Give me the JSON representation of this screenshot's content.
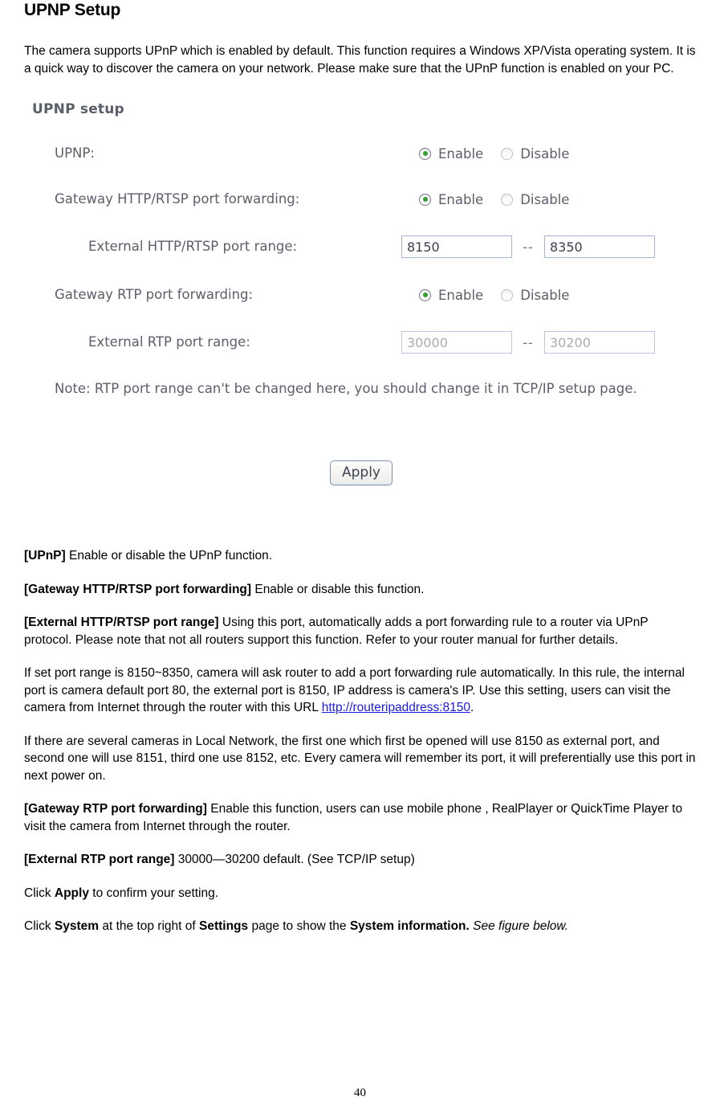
{
  "document": {
    "title": "UPNP Setup",
    "intro": "The camera supports UPnP which is enabled by default. This function requires a Windows XP/Vista operating system. It is a quick way to discover the camera on your network. Please make sure that the UPnP function is enabled on your PC.",
    "page_number": "40"
  },
  "screenshot": {
    "heading": "UPNP setup",
    "rows": {
      "upnp": {
        "label": "UPNP:",
        "enable_label": "Enable",
        "disable_label": "Disable",
        "selected": "Enable"
      },
      "gateway_http": {
        "label": "Gateway HTTP/RTSP port forwarding:",
        "enable_label": "Enable",
        "disable_label": "Disable",
        "selected": "Enable"
      },
      "external_http_range": {
        "label": "External HTTP/RTSP port range:",
        "from_value": "8150",
        "separator": "--",
        "to_value": "8350"
      },
      "gateway_rtp": {
        "label": "Gateway RTP port forwarding:",
        "enable_label": "Enable",
        "disable_label": "Disable",
        "selected": "Enable"
      },
      "external_rtp_range": {
        "label": "External RTP port range:",
        "from_value": "30000",
        "separator": "--",
        "to_value": "30200"
      }
    },
    "note": "Note: RTP port range can't be changed here, you should change it in TCP/IP setup page.",
    "apply_label": "Apply",
    "colors": {
      "label_text": "#5b5f6b",
      "radio_selected_dot": "#2ea12e",
      "field_border": "#a6b6d2",
      "disabled_text": "#a9acb4",
      "button_border": "#7d93b5"
    }
  },
  "explanations": {
    "p1_term": "[UPnP]",
    "p1_text": " Enable or disable the UPnP function.",
    "p2_term": "[Gateway HTTP/RTSP port forwarding]",
    "p2_text": " Enable or disable this function.",
    "p3_term": "[External HTTP/RTSP port range]",
    "p3_text": " Using this port, automatically adds a port forwarding rule to a router via UPnP protocol. Please note that not all routers support this function. Refer to your router manual for further details.",
    "p4_before_link": "If set port range is 8150~8350, camera will ask router to add a port forwarding rule automatically. In this rule, the internal port is camera default port 80, the external port is 8150, IP address is camera's IP. Use this setting, users can visit the camera from Internet through the router with this URL ",
    "p4_link": "http://routeripaddress:8150",
    "p4_after_link": ".",
    "p5_text": "If there are several cameras in Local Network, the first one which first be opened will use 8150 as external port, and second one will use 8151, third one use 8152, etc. Every camera will remember its port, it will preferentially use this port in next power on.",
    "p6_term": "[Gateway RTP port forwarding]",
    "p6_text": " Enable this function, users can use mobile phone , RealPlayer or QuickTime Player to visit the camera from Internet through the router.",
    "p7_term": "[External RTP port range]",
    "p7_text": " 30000—30200 default. (See TCP/IP setup)",
    "p8_a": "Click ",
    "p8_bold": "Apply",
    "p8_b": " to confirm your setting.",
    "p9_a": "Click ",
    "p9_bold1": "System",
    "p9_b": " at the top right of ",
    "p9_bold2": "Settings",
    "p9_c": " page to show the ",
    "p9_bold3": "System information.",
    "p9_italic": " See figure below."
  }
}
